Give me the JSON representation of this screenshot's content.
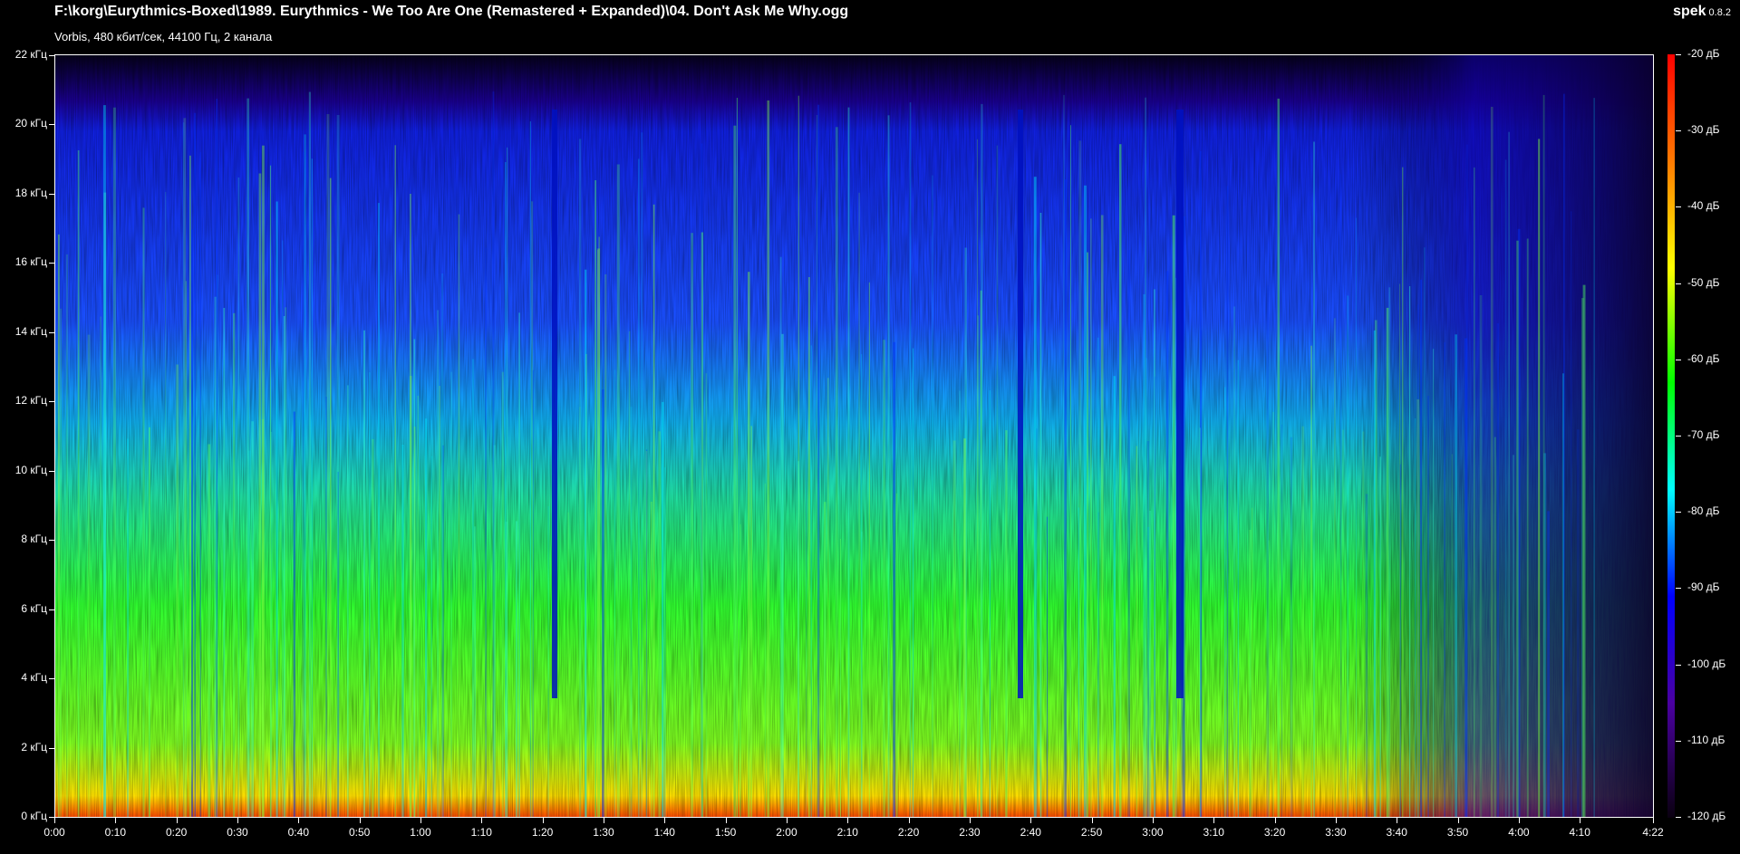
{
  "window": {
    "title": "F:\\korg\\Eurythmics-Boxed\\1989. Eurythmics - We Too Are One (Remastered + Expanded)\\04. Don't Ask Me Why.ogg",
    "subtitle": "Vorbis, 480 кбит/сек, 44100 Гц, 2 канала",
    "app_name": "spek",
    "app_version": "0.8.2"
  },
  "colors": {
    "background": "#000000",
    "text": "#ffffff",
    "scale": [
      "#ff0000",
      "#ff7a00",
      "#ffff00",
      "#00ff00",
      "#00ffff",
      "#0000ff",
      "#4a00a0",
      "#0a0010"
    ]
  },
  "chart_data": {
    "type": "heatmap",
    "x_unit": "time",
    "x_range": [
      "0:00",
      "4:22"
    ],
    "y_unit": "kHz",
    "y_range": [
      0,
      22
    ],
    "color_range_db": [
      -120,
      -20
    ],
    "frequency_labels": [
      "0 кГц",
      "2 кГц",
      "4 кГц",
      "6 кГц",
      "8 кГц",
      "10 кГц",
      "12 кГц",
      "14 кГц",
      "16 кГц",
      "18 кГц",
      "20 кГц",
      "22 кГц"
    ],
    "time_labels": [
      "0:00",
      "0:10",
      "0:20",
      "0:30",
      "0:40",
      "0:50",
      "1:00",
      "1:10",
      "1:20",
      "1:30",
      "1:40",
      "1:50",
      "2:00",
      "2:10",
      "2:20",
      "2:30",
      "2:40",
      "2:50",
      "3:00",
      "3:10",
      "3:20",
      "3:30",
      "3:40",
      "3:50",
      "4:00",
      "4:10",
      "4:22"
    ],
    "db_labels": [
      "-20 дБ",
      "-30 дБ",
      "-40 дБ",
      "-50 дБ",
      "-60 дБ",
      "-70 дБ",
      "-80 дБ",
      "-90 дБ",
      "-100 дБ",
      "-110 дБ",
      "-120 дБ"
    ]
  }
}
